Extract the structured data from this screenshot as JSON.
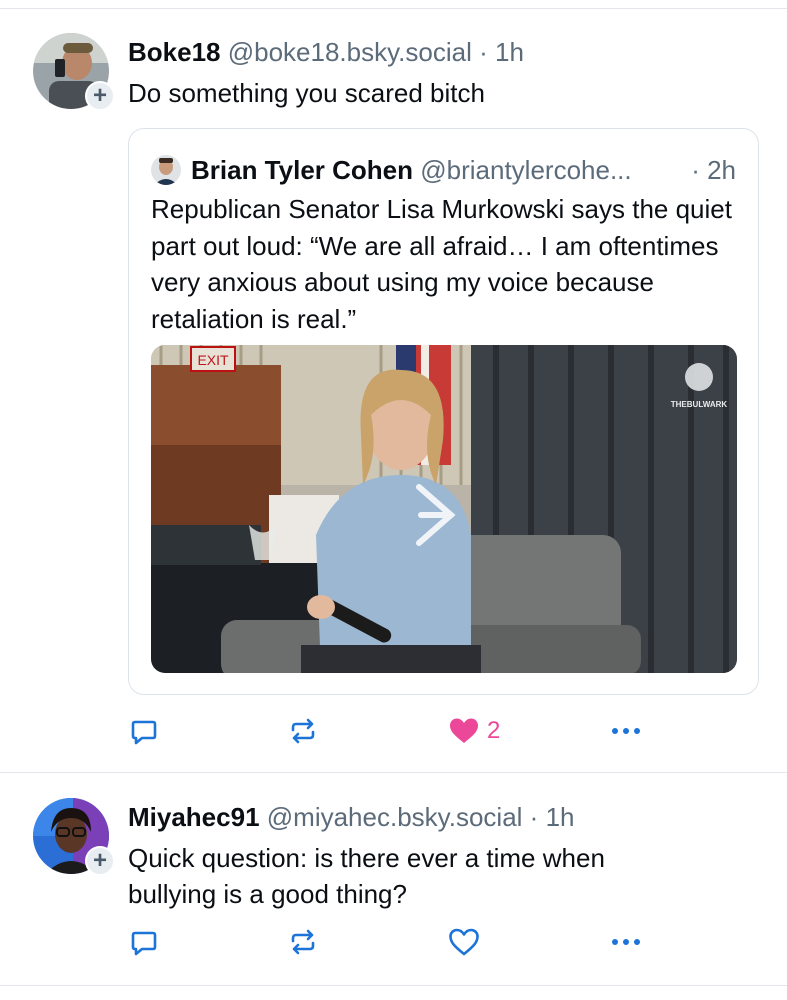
{
  "post1": {
    "name": "Boke18",
    "handle": "@boke18.bsky.social",
    "separator": "·",
    "time": "1h",
    "text": "Do something you scared bitch",
    "quote": {
      "name": "Brian Tyler Cohen",
      "handle": "@briantylercohe...",
      "time": "· 2h",
      "text": "Republican Senator Lisa Murkowski says the quiet part out loud: “We are all afraid… I am oftentimes very anxious about using my voice because retaliation is real.”",
      "media_sign": "EXIT",
      "watermark": "THEBULWARK"
    },
    "actions": {
      "reply_icon": "reply-icon",
      "repost_icon": "repost-icon",
      "like_icon": "heart-filled-icon",
      "like_count": "2",
      "more_icon": "more-icon",
      "like_color": "#ec4899"
    }
  },
  "post2": {
    "name": "Miyahec91",
    "handle": "@miyahec.bsky.social",
    "separator": "·",
    "time": "1h",
    "text": "Quick question: is there ever a time when bullying is a good thing?",
    "actions": {
      "reply_icon": "reply-icon",
      "repost_icon": "repost-icon",
      "like_icon": "heart-outline-icon",
      "more_icon": "more-icon"
    }
  },
  "colors": {
    "accent": "#1d74d8",
    "icon": "#1d74d8",
    "muted": "#5c6b7a",
    "like": "#ec4899"
  }
}
